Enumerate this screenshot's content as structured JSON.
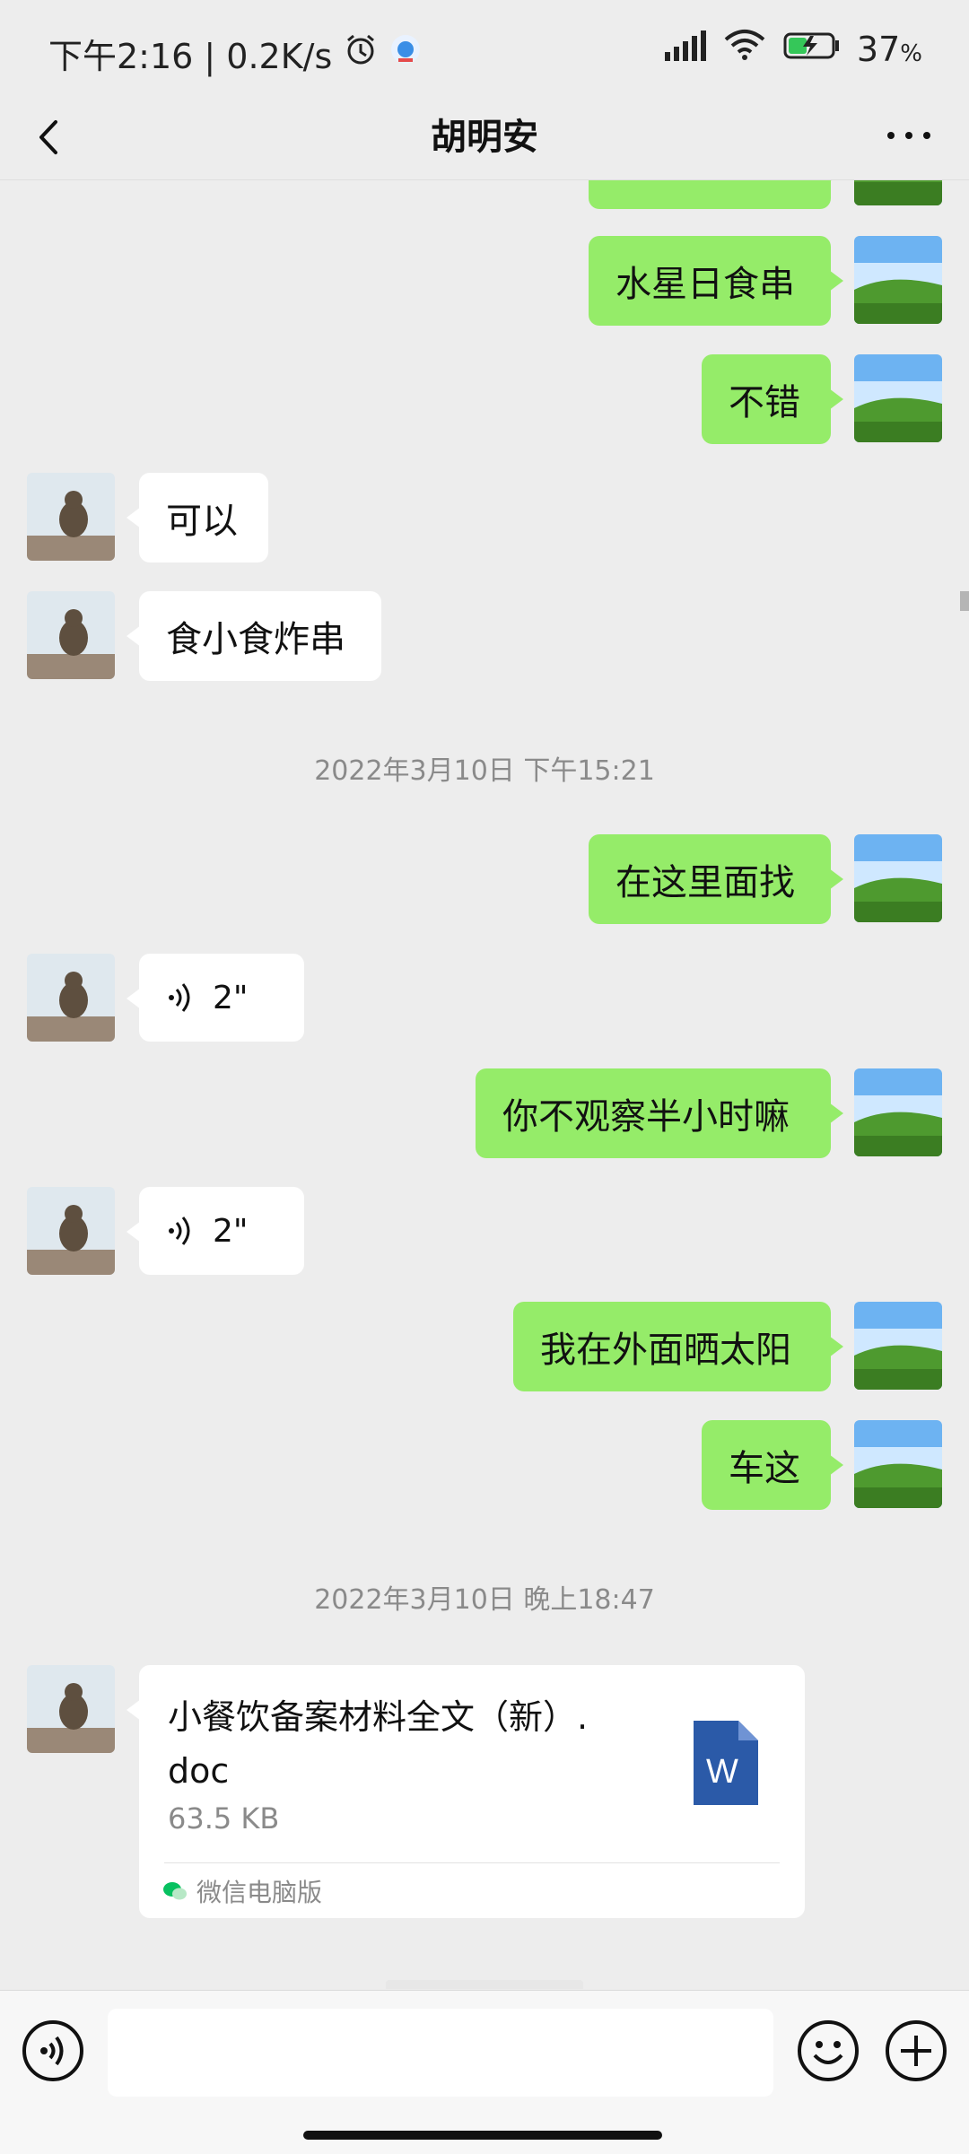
{
  "status_bar": {
    "time_speed": "下午2:16 | 0.2K/s",
    "battery_percent": "37",
    "battery_unit": "%"
  },
  "header": {
    "title": "胡明安"
  },
  "messages": {
    "m1": "水星日食串",
    "m2": "不错",
    "m3": "可以",
    "m4": "食小食炸串",
    "m5": "在这里面找",
    "m6_duration": "2\"",
    "m7": "你不观察半小时嘛",
    "m8_duration": "2\"",
    "m9": "我在外面晒太阳",
    "m10": "车这"
  },
  "timestamps": {
    "t1": "2022年3月10日 下午15:21",
    "t2": "2022年3月10日 晚上18:47"
  },
  "file_message": {
    "file_name_line1": "小餐饮备案材料全文（新）.",
    "file_name_line2": "doc",
    "file_size": "63.5 KB",
    "source": "微信电脑版",
    "icon_letter": "W"
  },
  "colors": {
    "outgoing_bubble": "#95ec69",
    "incoming_bubble": "#ffffff",
    "background": "#ededed"
  }
}
